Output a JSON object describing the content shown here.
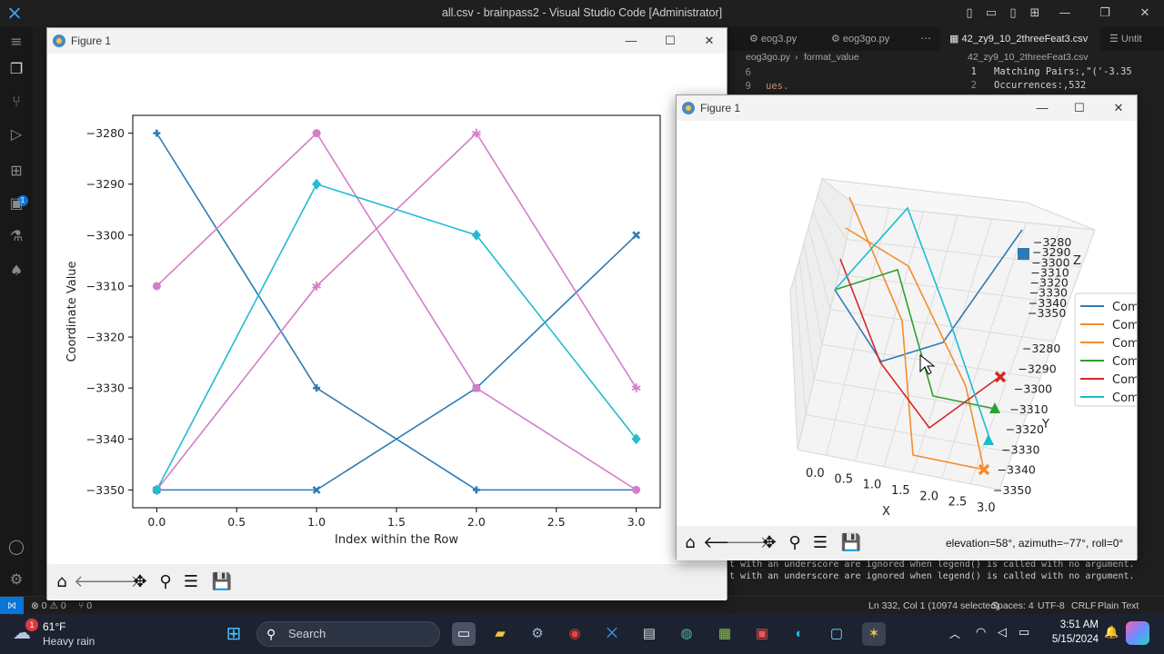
{
  "vscode": {
    "window_title": "all.csv - brainpass2 - Visual Studio Code [Administrator]",
    "tabs": [
      {
        "label": "eog3.py"
      },
      {
        "label": "eog3go.py"
      },
      {
        "label": "42_zy9_10_2threeFeat3.csv"
      },
      {
        "label": "Untit"
      }
    ],
    "breadcrumb_left": [
      "eog3go.py",
      "format_value"
    ],
    "breadcrumb_right": "42_zy9_10_2threeFeat3.csv",
    "left_code": [
      {
        "num": "6",
        "text": ""
      },
      {
        "num": "9",
        "text": "ues."
      }
    ],
    "right_code": [
      {
        "num": "1",
        "text": "Matching Pairs:,\"('-3.35"
      },
      {
        "num": "2",
        "text": "Occurrences:,532"
      }
    ],
    "terminal_lines": [
      "t with an underscore are ignored when legend() is called with no argument.",
      "t with an underscore are ignored when legend() is called with no argument."
    ],
    "status": {
      "errors": "0",
      "warnings": "0",
      "ports": "0",
      "position": "Ln 332, Col 1 (10974 selected)",
      "spaces": "Spaces: 4",
      "encoding": "UTF-8",
      "eol": "CRLF",
      "language": "Plain Text"
    }
  },
  "figure1": {
    "title": "Figure 1",
    "chart_data": {
      "type": "line",
      "xlabel": "Index within the Row",
      "ylabel": "Coordinate Value",
      "x_ticks": [
        "0.0",
        "0.5",
        "1.0",
        "1.5",
        "2.0",
        "2.5",
        "3.0"
      ],
      "y_ticks": [
        "−3280",
        "−3290",
        "−3300",
        "−3310",
        "−3320",
        "−3330",
        "−3340",
        "−3350"
      ],
      "xlim": [
        -0.15,
        3.15
      ],
      "ylim": [
        -3353.5,
        -3276.5
      ],
      "x": [
        0,
        1,
        2,
        3
      ],
      "series": [
        {
          "color": "#2c7bb6",
          "marker": "plus",
          "values": [
            -3280,
            -3330,
            -3350,
            -3350
          ]
        },
        {
          "color": "#2c7bb6",
          "marker": "x",
          "values": [
            -3350,
            -3350,
            -3330,
            -3300
          ]
        },
        {
          "color": "#d47dc8",
          "marker": "circle",
          "values": [
            -3310,
            -3280,
            -3330,
            -3350
          ]
        },
        {
          "color": "#d47dc8",
          "marker": "star",
          "values": [
            -3350,
            -3310,
            -3280,
            -3330
          ]
        },
        {
          "color": "#23bcd1",
          "marker": "diamond",
          "values": [
            -3350,
            -3290,
            -3300,
            -3340
          ]
        }
      ]
    }
  },
  "figure2": {
    "title": "Figure 1",
    "coords": "elevation=58°, azimuth=−77°, roll=0°",
    "chart_data": {
      "type": "line",
      "projection": "3d",
      "xlabel": "X",
      "ylabel": "Y",
      "zlabel": "Z",
      "x_ticks": [
        "0.0",
        "0.5",
        "1.0",
        "1.5",
        "2.0",
        "2.5",
        "3.0"
      ],
      "y_ticks": [
        "3280",
        "3290",
        "3300",
        "3310",
        "3320",
        "3330",
        "3340",
        "3350"
      ],
      "y_tick_signs": "−",
      "z_ticks": [
        "−3280",
        "−3290",
        "−3300",
        "−3310",
        "−3320",
        "−3330",
        "−3340",
        "−3350"
      ],
      "legend": {
        "position": "right",
        "entries": [
          {
            "label": "Com",
            "color": "#2c7bb6"
          },
          {
            "label": "Com",
            "color": "#f28e2b"
          },
          {
            "label": "Com",
            "color": "#f28e2b"
          },
          {
            "label": "Com",
            "color": "#2ca02c"
          },
          {
            "label": "Com",
            "color": "#d62728"
          },
          {
            "label": "Com",
            "color": "#17becf"
          }
        ]
      }
    }
  },
  "taskbar": {
    "weather_temp": "61°F",
    "weather_desc": "Heavy rain",
    "weather_badge": "1",
    "search_placeholder": "Search",
    "time": "3:51 AM",
    "date": "5/15/2024"
  }
}
